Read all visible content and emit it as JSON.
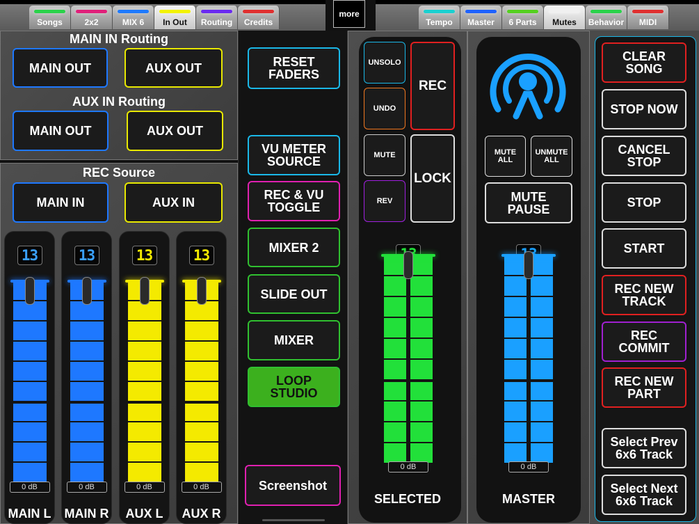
{
  "tabs_left": [
    {
      "label": "Songs",
      "color": "#2ad24a",
      "active": false
    },
    {
      "label": "2x2",
      "color": "#e0207a",
      "active": false
    },
    {
      "label": "MIX 6",
      "color": "#1e7aff",
      "active": false
    },
    {
      "label": "In Out",
      "color": "#f2f200",
      "active": true
    },
    {
      "label": "Routing",
      "color": "#6a2af0",
      "active": false
    },
    {
      "label": "Credits",
      "color": "#e03030",
      "active": false
    }
  ],
  "more_label": "more",
  "tabs_right": [
    {
      "label": "Tempo",
      "color": "#1ad0d0",
      "active": false
    },
    {
      "label": "Master",
      "color": "#1e62ff",
      "active": false
    },
    {
      "label": "6 Parts",
      "color": "#55d020",
      "active": false
    },
    {
      "label": "Mutes",
      "color": "#f0f0f0",
      "active": true
    },
    {
      "label": "Behavior",
      "color": "#2ad24a",
      "active": false
    },
    {
      "label": "MIDI",
      "color": "#e03030",
      "active": false
    }
  ],
  "routing": {
    "main_in_title": "MAIN IN  Routing",
    "aux_in_title": "AUX IN  Routing",
    "main_out": "MAIN OUT",
    "aux_out": "AUX OUT"
  },
  "rec_source": {
    "title": "REC  Source",
    "main_in": "MAIN IN",
    "aux_in": "AUX IN"
  },
  "faders": [
    {
      "name": "MAIN L",
      "readout": "13",
      "db": "0 dB",
      "color": "#1e78ff",
      "readout_color": "#3aa0ff"
    },
    {
      "name": "MAIN R",
      "readout": "13",
      "db": "0 dB",
      "color": "#1e78ff",
      "readout_color": "#3aa0ff"
    },
    {
      "name": "AUX L",
      "readout": "13",
      "db": "0 dB",
      "color": "#f4ea00",
      "readout_color": "#f4ea00"
    },
    {
      "name": "AUX R",
      "readout": "13",
      "db": "0 dB",
      "color": "#f4ea00",
      "readout_color": "#f4ea00"
    }
  ],
  "middle_buttons": {
    "reset_faders": [
      "RESET",
      "FADERS"
    ],
    "vu_meter_source": [
      "VU METER",
      "SOURCE"
    ],
    "rec_vu_toggle": [
      "REC & VU",
      "TOGGLE"
    ],
    "mixer2": "MIXER 2",
    "slide_out": "SLIDE OUT",
    "mixer": "MIXER",
    "loop_studio": [
      "LOOP",
      "STUDIO"
    ],
    "screenshot": "Screenshot"
  },
  "selected": {
    "unsolo": "UNSOLO",
    "undo": "UNDO",
    "mute": "MUTE",
    "rev": "REV",
    "rec": "REC",
    "lock": "LOCK",
    "readout": "13",
    "db": "0 dB",
    "name": "SELECTED",
    "color": "#22e03a"
  },
  "master": {
    "mute_all": [
      "MUTE",
      "ALL"
    ],
    "unmute_all": [
      "UNMUTE",
      "ALL"
    ],
    "mute_pause": [
      "MUTE",
      "PAUSE"
    ],
    "readout": "13",
    "db": "0 dB",
    "name": "MASTER",
    "color": "#1aa0ff"
  },
  "right_buttons": [
    {
      "key": "clear_song",
      "lines": [
        "CLEAR",
        "SONG"
      ],
      "border": "#e02020"
    },
    {
      "key": "stop_now",
      "lines": [
        "STOP NOW"
      ],
      "border": "#dddddd"
    },
    {
      "key": "cancel_stop",
      "lines": [
        "CANCEL",
        "STOP"
      ],
      "border": "#dddddd"
    },
    {
      "key": "stop",
      "lines": [
        "STOP"
      ],
      "border": "#dddddd"
    },
    {
      "key": "start",
      "lines": [
        "START"
      ],
      "border": "#dddddd"
    },
    {
      "key": "rec_new_track",
      "lines": [
        "REC NEW",
        "TRACK"
      ],
      "border": "#e02020"
    },
    {
      "key": "rec_commit",
      "lines": [
        "REC",
        "COMMIT"
      ],
      "border": "#a020d0"
    },
    {
      "key": "rec_new_part",
      "lines": [
        "REC NEW",
        "PART"
      ],
      "border": "#e02020"
    },
    {
      "key": "select_prev",
      "lines": [
        "Select Prev",
        "6x6 Track"
      ],
      "border": "#dddddd"
    },
    {
      "key": "select_next",
      "lines": [
        "Select Next",
        "6x6 Track"
      ],
      "border": "#dddddd"
    }
  ],
  "colors": {
    "blue_border": "#1e78ff",
    "yellow_border": "#e8e800",
    "cyan_border": "#1ab8e8",
    "magenta_border": "#e020b0",
    "green_border": "#30c030",
    "orange_border": "#f07820",
    "purple_border": "#a020e0",
    "red_border": "#e02020"
  }
}
